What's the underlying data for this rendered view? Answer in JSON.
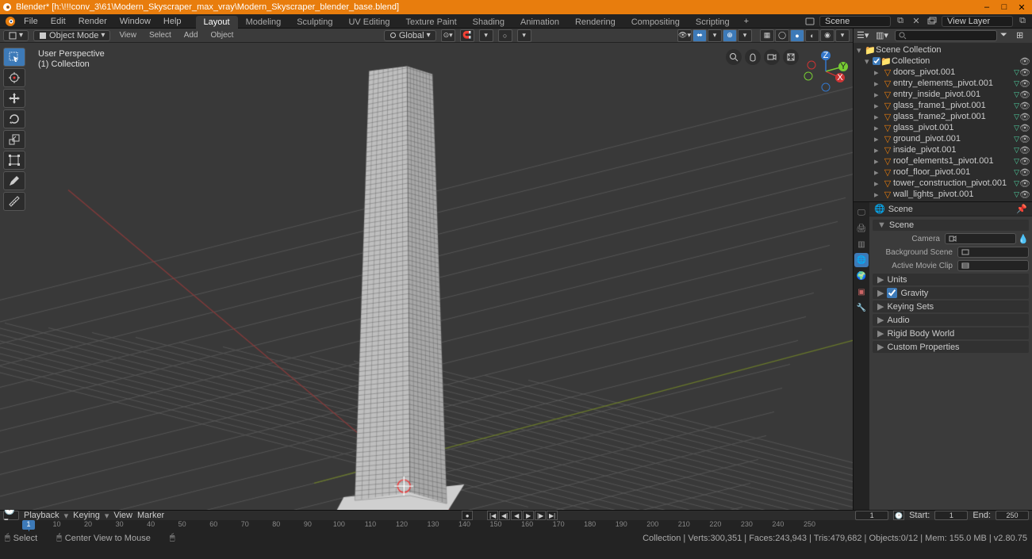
{
  "app": {
    "title": "Blender* [h:\\!!!conv_3\\61\\Modern_Skyscraper_max_vray\\Modern_Skyscraper_blender_base.blend]"
  },
  "menus": [
    "File",
    "Edit",
    "Render",
    "Window",
    "Help"
  ],
  "workspaces": [
    "Layout",
    "Modeling",
    "Sculpting",
    "UV Editing",
    "Texture Paint",
    "Shading",
    "Animation",
    "Rendering",
    "Compositing",
    "Scripting"
  ],
  "active_workspace": "Layout",
  "scene_selector": {
    "label": "Scene",
    "value": "Scene"
  },
  "viewlayer_selector": {
    "label": "View Layer",
    "value": "View Layer"
  },
  "viewport": {
    "mode": "Object Mode",
    "menus": [
      "View",
      "Select",
      "Add",
      "Object"
    ],
    "orientation": "Global",
    "overlay_label1": "User Perspective",
    "overlay_label2": "(1) Collection"
  },
  "outliner": {
    "root": "Scene Collection",
    "collection": "Collection",
    "items": [
      "doors_pivot.001",
      "entry_elements_pivot.001",
      "entry_inside_pivot.001",
      "glass_frame1_pivot.001",
      "glass_frame2_pivot.001",
      "glass_pivot.001",
      "ground_pivot.001",
      "inside_pivot.001",
      "roof_elements1_pivot.001",
      "roof_floor_pivot.001",
      "tower_construction_pivot.001",
      "wall_lights_pivot.001"
    ]
  },
  "properties": {
    "context": "Scene",
    "scene_panel": {
      "title": "Scene",
      "camera": "Camera",
      "bg_scene_label": "Background Scene",
      "bg_scene_value": "",
      "active_clip_label": "Active Movie Clip",
      "active_clip_value": ""
    },
    "sections": [
      "Units",
      "Gravity",
      "Keying Sets",
      "Audio",
      "Rigid Body World",
      "Custom Properties"
    ],
    "gravity_checked": true
  },
  "timeline": {
    "menus": [
      "Playback",
      "Keying",
      "View",
      "Marker"
    ],
    "current": 1,
    "start_label": "Start:",
    "start": 1,
    "end_label": "End:",
    "end": 250,
    "ticks": [
      0,
      10,
      20,
      30,
      40,
      50,
      60,
      70,
      80,
      90,
      100,
      110,
      120,
      130,
      140,
      150,
      160,
      170,
      180,
      190,
      200,
      210,
      220,
      230,
      240,
      250
    ]
  },
  "status": {
    "left1": "Select",
    "left2": "Center View to Mouse",
    "right": "Collection | Verts:300,351 | Faces:243,943 | Tris:479,682 | Objects:0/12 | Mem: 155.0 MB | v2.80.75"
  }
}
